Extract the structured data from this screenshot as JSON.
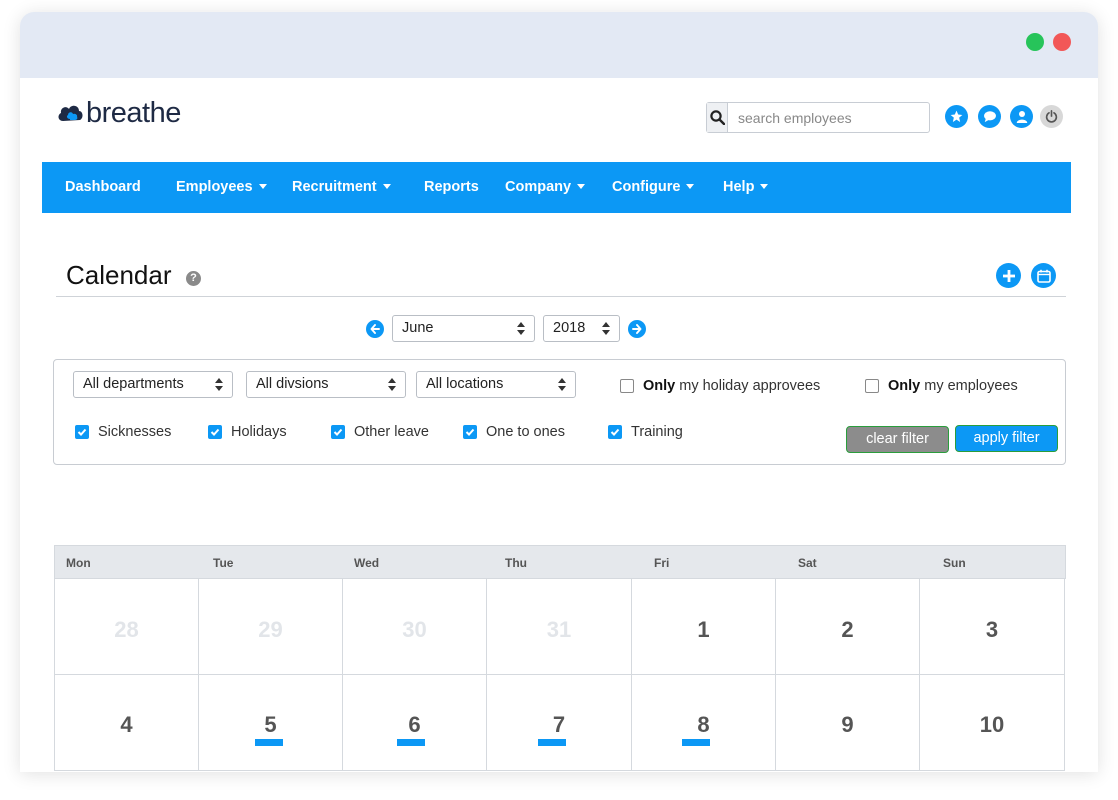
{
  "app": {
    "logo_text": "breathe",
    "brand_color": "#0c98f5"
  },
  "header": {
    "search": {
      "placeholder": "search employees",
      "value": ""
    },
    "icons": [
      "star-icon",
      "chat-icon",
      "user-icon",
      "power-icon"
    ]
  },
  "nav": {
    "items": [
      {
        "label": "Dashboard",
        "dropdown": false
      },
      {
        "label": "Employees",
        "dropdown": true
      },
      {
        "label": "Recruitment",
        "dropdown": true
      },
      {
        "label": "Reports",
        "dropdown": false
      },
      {
        "label": "Company",
        "dropdown": true
      },
      {
        "label": "Configure",
        "dropdown": true
      },
      {
        "label": "Help",
        "dropdown": true
      }
    ]
  },
  "page": {
    "title": "Calendar",
    "help_glyph": "?"
  },
  "period": {
    "month": "June",
    "year": "2018"
  },
  "filters": {
    "department": "All departments",
    "division": "All divsions",
    "location": "All locations",
    "only_approvees": {
      "bold": "Only",
      "rest": "my holiday approvees",
      "checked": false
    },
    "only_employees": {
      "bold": "Only",
      "rest": "my employees",
      "checked": false
    },
    "types": [
      {
        "label": "Sicknesses",
        "checked": true
      },
      {
        "label": "Holidays",
        "checked": true
      },
      {
        "label": "Other leave",
        "checked": true
      },
      {
        "label": "One to ones",
        "checked": true
      },
      {
        "label": "Training",
        "checked": true
      }
    ],
    "clear_label": "clear filter",
    "apply_label": "apply filter"
  },
  "calendar": {
    "days_of_week": [
      "Mon",
      "Tue",
      "Wed",
      "Thu",
      "Fri",
      "Sat",
      "Sun"
    ],
    "weeks": [
      [
        {
          "day": "28",
          "muted": true,
          "event": false
        },
        {
          "day": "29",
          "muted": true,
          "event": false
        },
        {
          "day": "30",
          "muted": true,
          "event": false
        },
        {
          "day": "31",
          "muted": true,
          "event": false
        },
        {
          "day": "1",
          "muted": false,
          "event": false
        },
        {
          "day": "2",
          "muted": false,
          "event": false
        },
        {
          "day": "3",
          "muted": false,
          "event": false
        }
      ],
      [
        {
          "day": "4",
          "muted": false,
          "event": false
        },
        {
          "day": "5",
          "muted": false,
          "event": true
        },
        {
          "day": "6",
          "muted": false,
          "event": true
        },
        {
          "day": "7",
          "muted": false,
          "event": true
        },
        {
          "day": "8",
          "muted": false,
          "event": true
        },
        {
          "day": "9",
          "muted": false,
          "event": false
        },
        {
          "day": "10",
          "muted": false,
          "event": false
        }
      ]
    ]
  }
}
